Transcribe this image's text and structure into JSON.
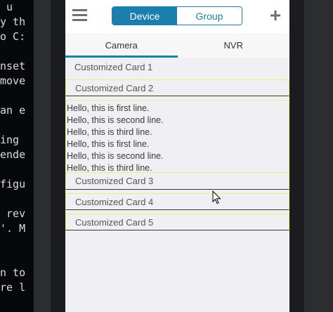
{
  "terminal": {
    "lines": [
      " u",
      "y th",
      "o C:",
      "",
      "nset",
      "move",
      "",
      "an e",
      "",
      "ing ",
      "ende",
      "",
      "figu",
      "",
      " rev",
      "'. M",
      "",
      "",
      "n to",
      "re l"
    ]
  },
  "header": {
    "segments": [
      {
        "label": "Device",
        "active": true
      },
      {
        "label": "Group",
        "active": false
      }
    ],
    "add_label": "+"
  },
  "tabs": [
    {
      "label": "Camera",
      "active": true
    },
    {
      "label": "NVR",
      "active": false
    }
  ],
  "cards": [
    {
      "title": "Customized Card 1"
    },
    {
      "title": "Customized Card 2",
      "expanded": true,
      "lines": [
        "Hello, this is first line.",
        "Hello, this is second line.",
        "Hello, this is third line.",
        "Hello, this is first line.",
        "Hello, this is second line.",
        "Hello, this is third line."
      ]
    },
    {
      "title": "Customized Card 3"
    },
    {
      "title": "Customized Card 4"
    },
    {
      "title": "Customized Card 5"
    }
  ],
  "colors": {
    "accent": "#1a7fad",
    "card_border": "#f2ec7a",
    "screen_bg": "#efeff4"
  }
}
